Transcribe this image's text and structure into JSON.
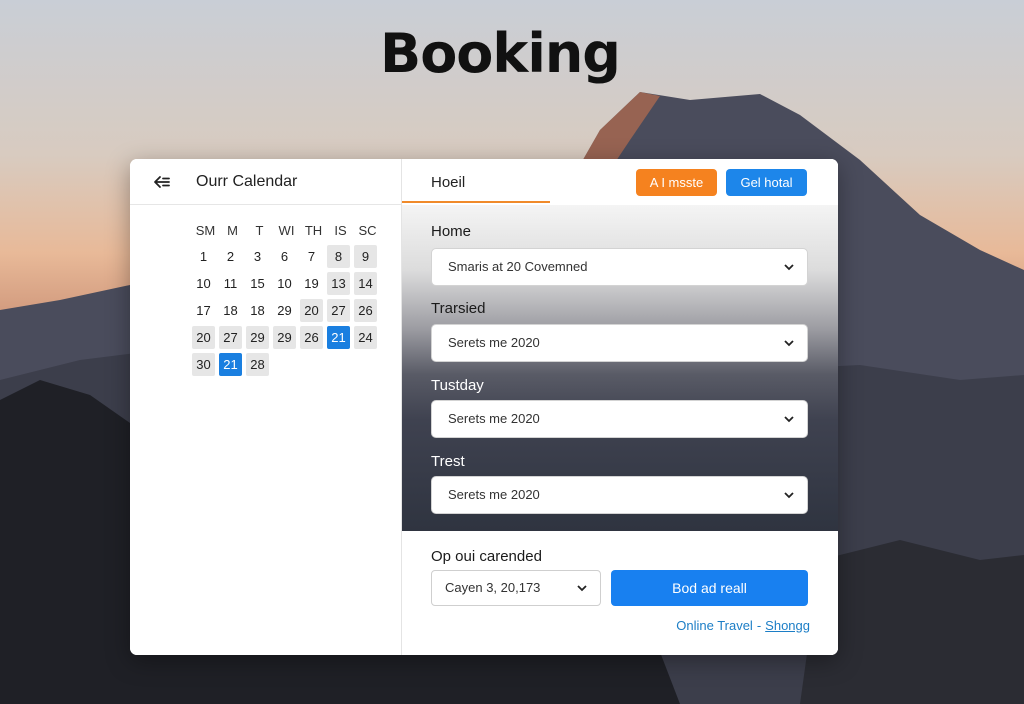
{
  "page": {
    "title": "Booking"
  },
  "calendar": {
    "back_icon": "back-arrow-icon",
    "title": "Ourr Calendar",
    "weekdays": [
      "SM",
      "M",
      "T",
      "WI",
      "TH",
      "IS",
      "SC"
    ],
    "weeks": [
      [
        "1",
        "2",
        "3",
        "6",
        "7",
        "8",
        "9"
      ],
      [
        "10",
        "11",
        "15",
        "10",
        "19",
        "13",
        "14"
      ],
      [
        "17",
        "18",
        "18",
        "29",
        "20",
        "27",
        "26"
      ],
      [
        "20",
        "27",
        "29",
        "29",
        "26",
        "21",
        "24"
      ],
      [
        "30",
        "21",
        "28"
      ]
    ],
    "selected_color": "#1a7fe0"
  },
  "header": {
    "tab_label": "Hoeil",
    "orange_button": "A I msste",
    "blue_button": "Gel hotal",
    "accent_orange": "#f5821f",
    "accent_blue": "#1d86ea"
  },
  "fields": [
    {
      "label": "Home",
      "value": "Smaris at 20 Covemned"
    },
    {
      "label": "Trarsied",
      "value": "Serets me 2020"
    },
    {
      "label": "Tustday",
      "value": "Serets me 2020"
    },
    {
      "label": "Trest",
      "value": "Serets me 2020"
    }
  ],
  "bottom": {
    "label": "Op oui carended",
    "date_value": "Cayen 3, 20,173",
    "book_button": "Bod ad reall",
    "footer_link_left": "Online Travel",
    "footer_sep": "-",
    "footer_link_right": "Shongg"
  }
}
